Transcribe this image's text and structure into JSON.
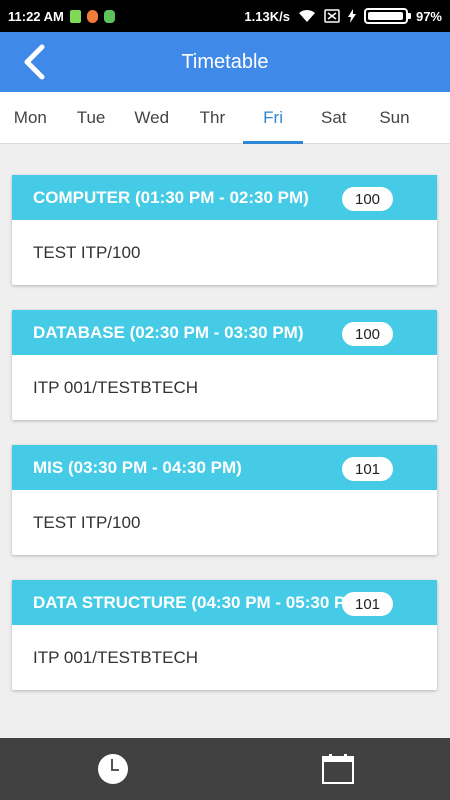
{
  "status_bar": {
    "time": "11:22 AM",
    "network_speed": "1.13K/s",
    "battery_percent": "97%",
    "battery_level": 0.97,
    "icons": [
      "sim-icon",
      "alarm-icon",
      "app-icon",
      "wifi-icon",
      "no-sim-icon",
      "charging-icon",
      "battery-icon"
    ]
  },
  "app_bar": {
    "title": "Timetable",
    "back_icon": "back-arrow-icon",
    "color": "#3f8ae8"
  },
  "tabs": [
    {
      "label": "Mon",
      "active": false
    },
    {
      "label": "Tue",
      "active": false
    },
    {
      "label": "Wed",
      "active": false
    },
    {
      "label": "Thr",
      "active": false
    },
    {
      "label": "Fri",
      "active": true
    },
    {
      "label": "Sat",
      "active": false
    },
    {
      "label": "Sun",
      "active": false
    }
  ],
  "accent_color": "#2f86d4",
  "card_header_color": "#45cbe6",
  "schedule": [
    {
      "subject": "COMPUTER (01:30 PM - 02:30 PM)",
      "room": "100",
      "detail": "TEST ITP/100"
    },
    {
      "subject": "DATABASE (02:30 PM - 03:30 PM)",
      "room": "100",
      "detail": "ITP 001/TESTBTECH"
    },
    {
      "subject": "MIS (03:30 PM - 04:30 PM)",
      "room": "101",
      "detail": "TEST ITP/100"
    },
    {
      "subject": "DATA STRUCTURE (04:30 PM - 05:30 PM)",
      "room": "101",
      "detail": "ITP 001/TESTBTECH"
    }
  ],
  "bottom_nav": [
    {
      "icon": "clock-icon"
    },
    {
      "icon": "calendar-icon"
    }
  ]
}
